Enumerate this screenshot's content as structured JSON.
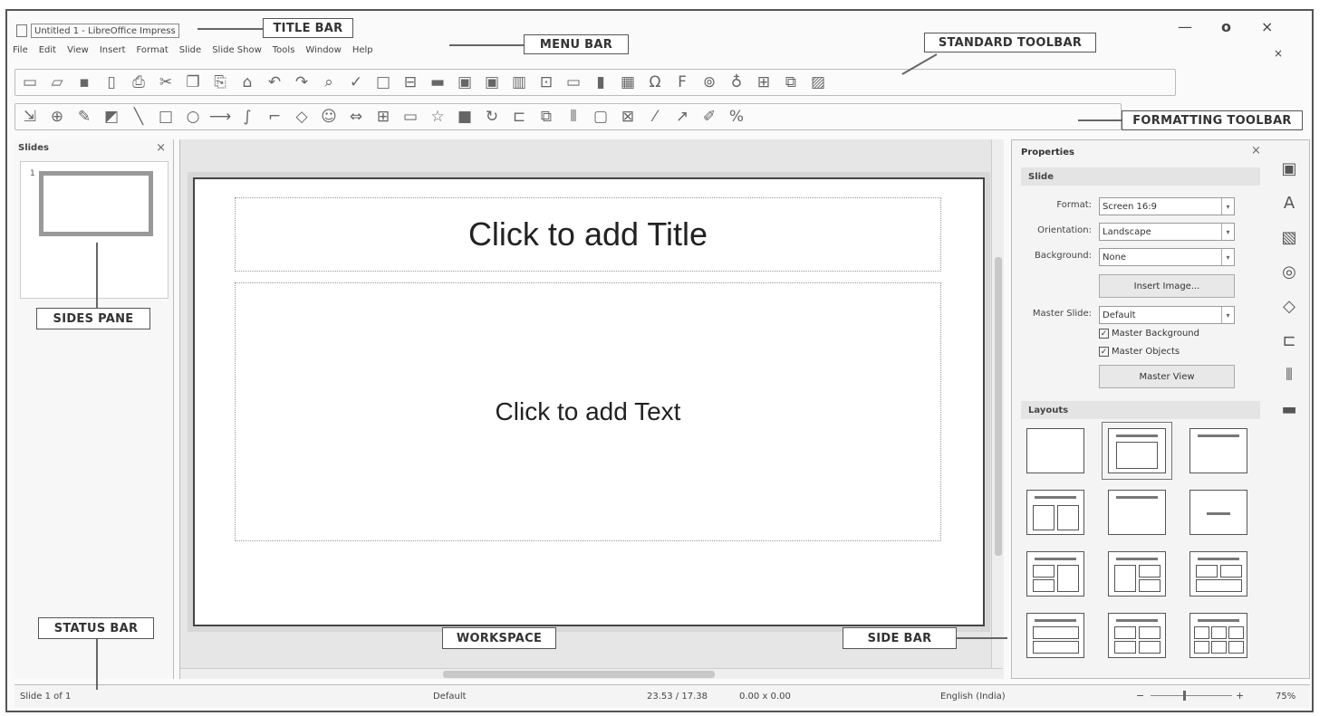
{
  "window": {
    "title": "Untitled 1 - LibreOffice Impress",
    "minimize": "—",
    "maximize": "o",
    "close": "×",
    "doc_close": "×"
  },
  "menu": [
    "File",
    "Edit",
    "View",
    "Insert",
    "Format",
    "Slide",
    "Slide Show",
    "Tools",
    "Window",
    "Help"
  ],
  "slides_pane": {
    "title": "Slides",
    "close": "×",
    "slide_number": "1"
  },
  "slide": {
    "title_placeholder": "Click to add Title",
    "text_placeholder": "Click to add Text"
  },
  "sidebar": {
    "title": "Properties",
    "close": "×",
    "slide_section": "Slide",
    "format_label": "Format:",
    "format_value": "Screen 16:9",
    "orientation_label": "Orientation:",
    "orientation_value": "Landscape",
    "background_label": "Background:",
    "background_value": "None",
    "insert_image": "Insert Image...",
    "master_slide_label": "Master Slide:",
    "master_slide_value": "Default",
    "master_background": "Master Background",
    "master_objects": "Master Objects",
    "master_view": "Master View",
    "layouts_section": "Layouts"
  },
  "status": {
    "slide": "Slide 1 of 1",
    "master": "Default",
    "position": "23.53 / 17.38",
    "size": "0.00 x 0.00",
    "language": "English (India)",
    "zoom": "75%"
  },
  "callouts": {
    "title_bar": "TITLE BAR",
    "menu_bar": "MENU BAR",
    "standard_toolbar": "STANDARD TOOLBAR",
    "formatting_toolbar": "FORMATTING TOOLBAR",
    "slides_pane": "SIDES PANE",
    "status_bar": "STATUS BAR",
    "workspace": "WORKSPACE",
    "side_bar": "SIDE BAR"
  }
}
